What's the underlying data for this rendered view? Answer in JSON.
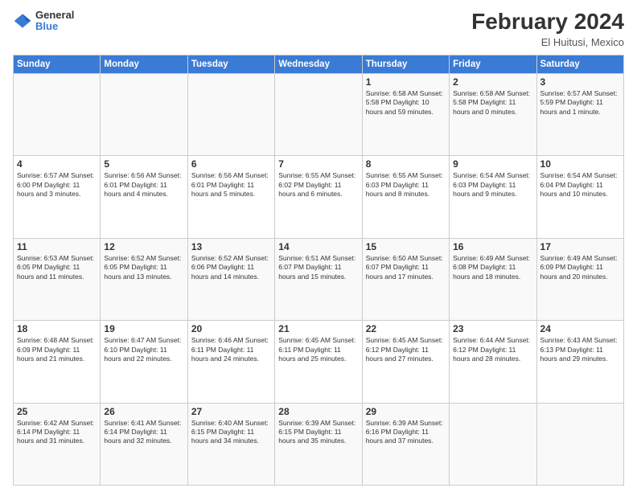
{
  "header": {
    "logo": {
      "general": "General",
      "blue": "Blue"
    },
    "title": "February 2024",
    "location": "El Huitusi, Mexico"
  },
  "days_of_week": [
    "Sunday",
    "Monday",
    "Tuesday",
    "Wednesday",
    "Thursday",
    "Friday",
    "Saturday"
  ],
  "weeks": [
    [
      {
        "day": "",
        "info": ""
      },
      {
        "day": "",
        "info": ""
      },
      {
        "day": "",
        "info": ""
      },
      {
        "day": "",
        "info": ""
      },
      {
        "day": "1",
        "info": "Sunrise: 6:58 AM\nSunset: 5:58 PM\nDaylight: 10 hours and 59 minutes."
      },
      {
        "day": "2",
        "info": "Sunrise: 6:58 AM\nSunset: 5:58 PM\nDaylight: 11 hours and 0 minutes."
      },
      {
        "day": "3",
        "info": "Sunrise: 6:57 AM\nSunset: 5:59 PM\nDaylight: 11 hours and 1 minute."
      }
    ],
    [
      {
        "day": "4",
        "info": "Sunrise: 6:57 AM\nSunset: 6:00 PM\nDaylight: 11 hours and 3 minutes."
      },
      {
        "day": "5",
        "info": "Sunrise: 6:56 AM\nSunset: 6:01 PM\nDaylight: 11 hours and 4 minutes."
      },
      {
        "day": "6",
        "info": "Sunrise: 6:56 AM\nSunset: 6:01 PM\nDaylight: 11 hours and 5 minutes."
      },
      {
        "day": "7",
        "info": "Sunrise: 6:55 AM\nSunset: 6:02 PM\nDaylight: 11 hours and 6 minutes."
      },
      {
        "day": "8",
        "info": "Sunrise: 6:55 AM\nSunset: 6:03 PM\nDaylight: 11 hours and 8 minutes."
      },
      {
        "day": "9",
        "info": "Sunrise: 6:54 AM\nSunset: 6:03 PM\nDaylight: 11 hours and 9 minutes."
      },
      {
        "day": "10",
        "info": "Sunrise: 6:54 AM\nSunset: 6:04 PM\nDaylight: 11 hours and 10 minutes."
      }
    ],
    [
      {
        "day": "11",
        "info": "Sunrise: 6:53 AM\nSunset: 6:05 PM\nDaylight: 11 hours and 11 minutes."
      },
      {
        "day": "12",
        "info": "Sunrise: 6:52 AM\nSunset: 6:05 PM\nDaylight: 11 hours and 13 minutes."
      },
      {
        "day": "13",
        "info": "Sunrise: 6:52 AM\nSunset: 6:06 PM\nDaylight: 11 hours and 14 minutes."
      },
      {
        "day": "14",
        "info": "Sunrise: 6:51 AM\nSunset: 6:07 PM\nDaylight: 11 hours and 15 minutes."
      },
      {
        "day": "15",
        "info": "Sunrise: 6:50 AM\nSunset: 6:07 PM\nDaylight: 11 hours and 17 minutes."
      },
      {
        "day": "16",
        "info": "Sunrise: 6:49 AM\nSunset: 6:08 PM\nDaylight: 11 hours and 18 minutes."
      },
      {
        "day": "17",
        "info": "Sunrise: 6:49 AM\nSunset: 6:09 PM\nDaylight: 11 hours and 20 minutes."
      }
    ],
    [
      {
        "day": "18",
        "info": "Sunrise: 6:48 AM\nSunset: 6:09 PM\nDaylight: 11 hours and 21 minutes."
      },
      {
        "day": "19",
        "info": "Sunrise: 6:47 AM\nSunset: 6:10 PM\nDaylight: 11 hours and 22 minutes."
      },
      {
        "day": "20",
        "info": "Sunrise: 6:46 AM\nSunset: 6:11 PM\nDaylight: 11 hours and 24 minutes."
      },
      {
        "day": "21",
        "info": "Sunrise: 6:45 AM\nSunset: 6:11 PM\nDaylight: 11 hours and 25 minutes."
      },
      {
        "day": "22",
        "info": "Sunrise: 6:45 AM\nSunset: 6:12 PM\nDaylight: 11 hours and 27 minutes."
      },
      {
        "day": "23",
        "info": "Sunrise: 6:44 AM\nSunset: 6:12 PM\nDaylight: 11 hours and 28 minutes."
      },
      {
        "day": "24",
        "info": "Sunrise: 6:43 AM\nSunset: 6:13 PM\nDaylight: 11 hours and 29 minutes."
      }
    ],
    [
      {
        "day": "25",
        "info": "Sunrise: 6:42 AM\nSunset: 6:14 PM\nDaylight: 11 hours and 31 minutes."
      },
      {
        "day": "26",
        "info": "Sunrise: 6:41 AM\nSunset: 6:14 PM\nDaylight: 11 hours and 32 minutes."
      },
      {
        "day": "27",
        "info": "Sunrise: 6:40 AM\nSunset: 6:15 PM\nDaylight: 11 hours and 34 minutes."
      },
      {
        "day": "28",
        "info": "Sunrise: 6:39 AM\nSunset: 6:15 PM\nDaylight: 11 hours and 35 minutes."
      },
      {
        "day": "29",
        "info": "Sunrise: 6:39 AM\nSunset: 6:16 PM\nDaylight: 11 hours and 37 minutes."
      },
      {
        "day": "",
        "info": ""
      },
      {
        "day": "",
        "info": ""
      }
    ]
  ]
}
